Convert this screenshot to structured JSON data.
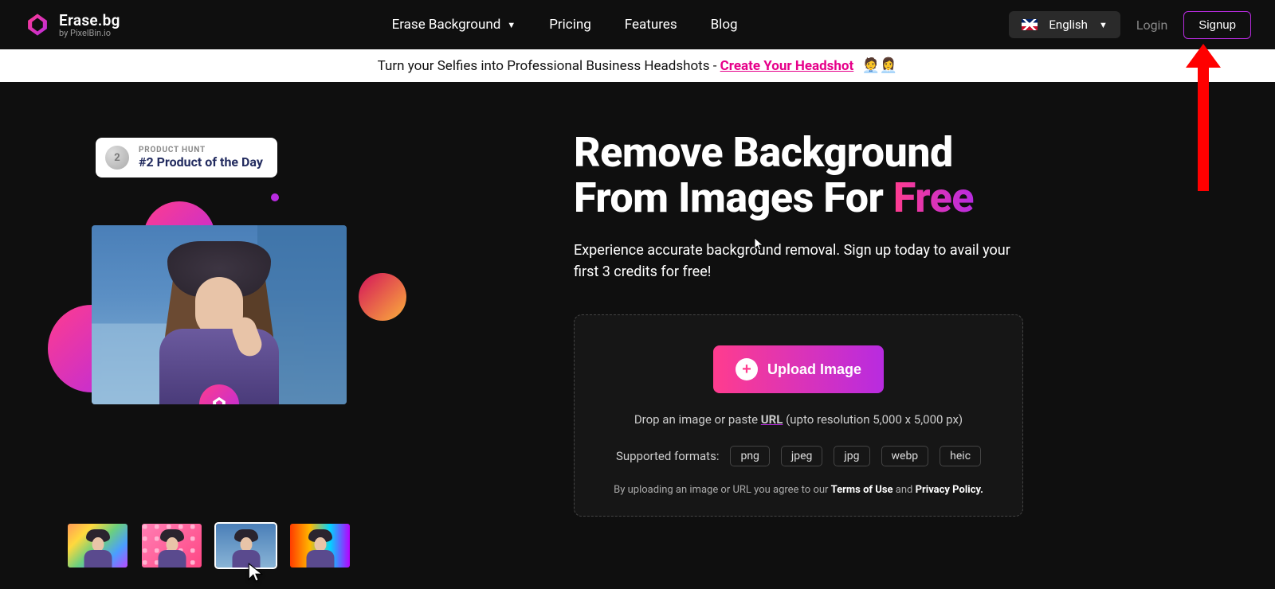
{
  "logo": {
    "main": "Erase.bg",
    "sub": "by PixelBin.io"
  },
  "nav": {
    "erase": "Erase Background",
    "pricing": "Pricing",
    "features": "Features",
    "blog": "Blog"
  },
  "lang": {
    "label": "English"
  },
  "auth": {
    "login": "Login",
    "signup": "Signup"
  },
  "banner": {
    "prefix": "Turn your Selfies into Professional Business Headshots - ",
    "link": "Create Your Headshot",
    "emoji": "🧑‍💼👩‍💼"
  },
  "product_hunt": {
    "label": "PRODUCT HUNT",
    "rank": "#2 Product of the Day",
    "medal": "2"
  },
  "hero": {
    "line1": "Remove Background",
    "line2_a": "From Images For ",
    "line2_b": "Free",
    "sub": "Experience accurate background removal. Sign up today to avail your first 3 credits for free!"
  },
  "upload": {
    "button": "Upload Image",
    "drop_prefix": "Drop an image or paste ",
    "drop_url": "URL",
    "drop_suffix": " (upto resolution 5,000 x 5,000 px)",
    "formats_label": "Supported formats:",
    "formats": [
      "png",
      "jpeg",
      "jpg",
      "webp",
      "heic"
    ],
    "terms_prefix": "By uploading an image or URL you agree to our ",
    "terms": "Terms of Use",
    "and": " and ",
    "privacy": "Privacy Policy."
  }
}
